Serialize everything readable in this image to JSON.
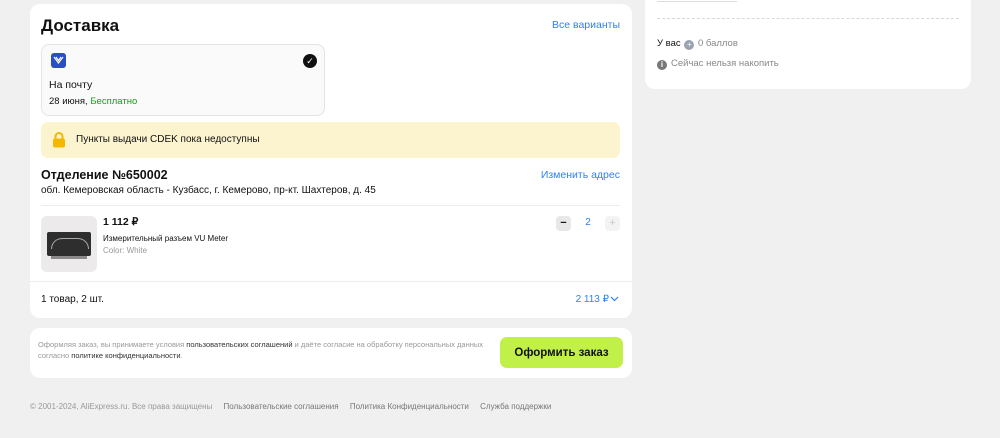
{
  "delivery": {
    "title": "Доставка",
    "all_variants": "Все варианты",
    "option": {
      "name": "На почту",
      "date": "28 июня,",
      "price": "Бесплатно"
    },
    "notice": "Пункты выдачи CDEK пока недоступны",
    "address": {
      "title": "Отделение №650002",
      "line": "обл. Кемеровская область - Кузбасс, г. Кемерово, пр-кт. Шахтеров, д. 45",
      "change": "Изменить адрес"
    },
    "product": {
      "price": "1 112 ₽",
      "name": "Измерительный разъем VU Meter",
      "color": "Color: White",
      "quantity": "2",
      "minus": "−",
      "plus": "+"
    },
    "summary": "1 товар, 2 шт.",
    "total": "2 113 ₽"
  },
  "order": {
    "terms_1": "Оформляя заказ, вы принимаете условия",
    "terms_link_1": "пользовательских соглашений",
    "terms_2": "и даёте согласие на обработку персональных данных согласно",
    "terms_link_2": "политике конфиденциальности",
    "terms_end": ".",
    "button": "Оформить заказ"
  },
  "footer": {
    "copyright": "© 2001-2024, AliExpress.ru. Все права защищены",
    "links": [
      "Пользовательские соглашения",
      "Политика Конфиденциальности",
      "Служба поддержки"
    ]
  },
  "side": {
    "bonus_prefix": "У вас",
    "bonus_value": "0 баллов",
    "no_accumulate": "Сейчас нельзя накопить"
  },
  "colors": {
    "accent_link": "#2f7ff5",
    "free": "#0fa30f",
    "order_button": "#c1f048",
    "warning_bg": "#fcf3cf"
  },
  "icons": [
    "russian-post-logo-icon",
    "checkmark-icon",
    "lock-icon",
    "minus-icon",
    "plus-icon",
    "chevron-down-icon",
    "coin-icon",
    "info-icon"
  ]
}
